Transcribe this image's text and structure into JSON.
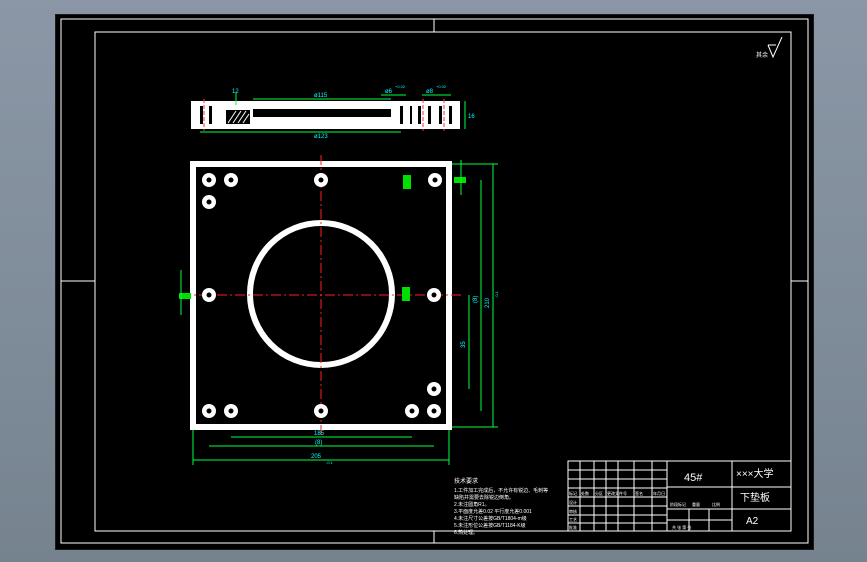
{
  "drawing": {
    "surface_finish_note": "其余",
    "top_view": {
      "dim_diameter_top": "ø115",
      "dim_diameter_bottom": "ø123",
      "dim_hole_1": "ø6",
      "dim_hole_1_tol": "+0.02",
      "dim_hole_2": "ø8",
      "dim_hole_2_tol": "+0.02",
      "dim_height": "16",
      "dim_small": "12"
    },
    "plan_view": {
      "dim_width_inner": "185",
      "dim_width_mid": "(8)",
      "dim_width_outer": "205",
      "dim_width_outer_tol": "-0.1",
      "dim_height_outer": "210",
      "dim_height_outer_tol": "-0.1",
      "dim_height_mid": "(8)",
      "dim_height_small": "35"
    },
    "tech_requirements": {
      "title": "技术要求",
      "lines": [
        "1.工件加工完成后，不允许有锐边、毛刺等",
        "  缺陷并需要去除锐边倒角。",
        "2.未注圆角R1。",
        "3.平面度允差0.02 平行度允差0.001",
        "4.未注尺寸公差按GB/T1804-m级",
        "5.未注形位公差按GB/T1184-K级",
        "6.热处理。"
      ]
    },
    "title_block": {
      "material": "45#",
      "school": "×××大学",
      "part_name": "下垫板",
      "sheet_size": "A2",
      "labels": [
        "标记",
        "处数",
        "分区",
        "更改文件号",
        "签名",
        "年月日",
        "设计",
        "审核",
        "工艺",
        "批准",
        "阶段标记",
        "重量",
        "比例",
        "共 张 第 张"
      ]
    }
  }
}
